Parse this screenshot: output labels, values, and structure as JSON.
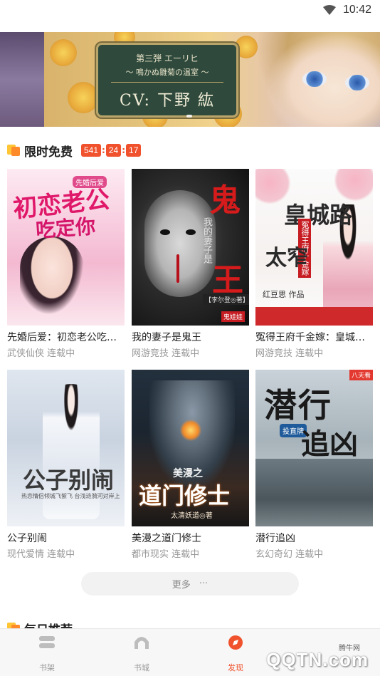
{
  "status_bar": {
    "time": "10:42"
  },
  "banner": {
    "line1": "第三弾 エーリヒ",
    "line2": "～ 鳴かぬ雛菊の温室 ～",
    "line3": "CV: 下野 紘"
  },
  "free_section": {
    "title": "限时免费",
    "timer": [
      "541",
      "24",
      "17"
    ]
  },
  "books": [
    {
      "name": "先婚后爱：初恋老公吃定你",
      "category": "武侠仙侠",
      "status": "连载中",
      "cover": {
        "title_a": "初恋老公",
        "title_b": "吃定你",
        "tag": "先婚后爱"
      }
    },
    {
      "name": "我的妻子是鬼王",
      "category": "网游竞技",
      "status": "连载中",
      "cover": {
        "title_a": "鬼",
        "title_b": "王",
        "sub": "我的妻子是",
        "author": "【李尔登◎著】",
        "pub": "鬼娃娃"
      }
    },
    {
      "name": "冤得王府千金嫁：皇城太窄路",
      "category": "网游竞技",
      "status": "连载中",
      "cover": {
        "title_a": "皇城路",
        "title_b": "太窄",
        "red": "冤得王府千金嫁",
        "author": "红豆思 作品"
      }
    },
    {
      "name": "公子别闹",
      "category": "现代爱情",
      "status": "连载中",
      "cover": {
        "title_a": "公子别闹",
        "sub": "热恋情侣倾城飞絮飞 台浅涟漪河对岸上"
      }
    },
    {
      "name": "美漫之道门修士",
      "category": "都市现实",
      "status": "连载中",
      "cover": {
        "title_top": "美漫之",
        "title_a": "道门修士",
        "author": "太清妖道◎著"
      }
    },
    {
      "name": "潜行追凶",
      "category": "玄幻奇幻",
      "status": "连载中",
      "cover": {
        "title_a": "潜行",
        "title_b": "追凶",
        "badge": "投直牌",
        "corner": "八天看"
      }
    }
  ],
  "more_button": {
    "label": "更多",
    "ellipsis": "···"
  },
  "daily_section": {
    "title": "每日推荐"
  },
  "bottom_nav": [
    {
      "label": "书架",
      "active": false
    },
    {
      "label": "书城",
      "active": false
    },
    {
      "label": "发现",
      "active": true
    }
  ],
  "watermark": {
    "text": "QQTN.com",
    "small": "腾牛网"
  },
  "colors": {
    "accent": "#f0522d",
    "timer_bg": "#f0522d",
    "icon_yellow": "#ffc535",
    "icon_orange": "#ff8a2a"
  }
}
